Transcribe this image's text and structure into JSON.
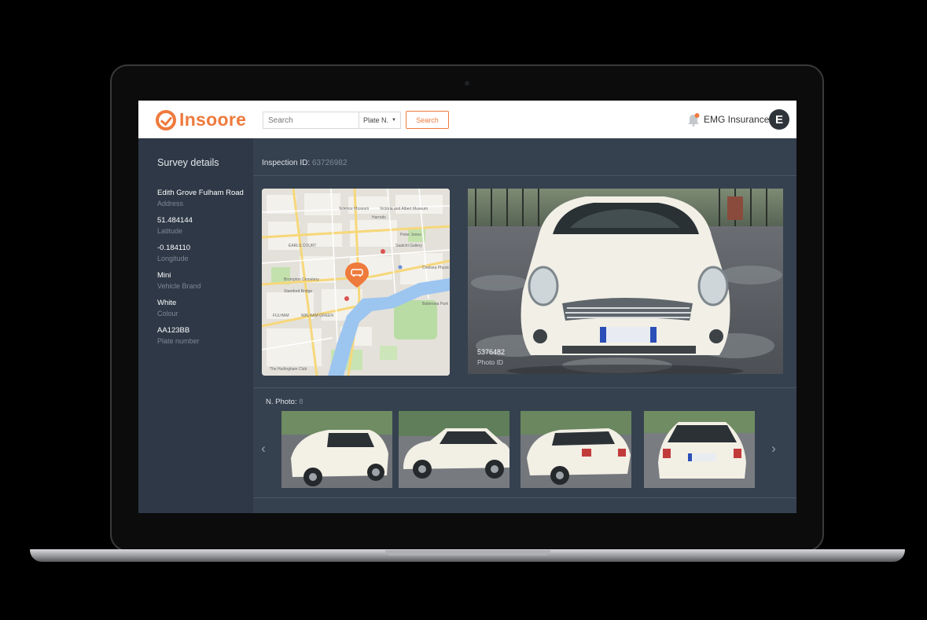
{
  "brand": {
    "name": "Insoore",
    "accent": "#ee7a3c"
  },
  "header": {
    "search_placeholder": "Search",
    "search_type": "Plate N.",
    "search_button": "Search",
    "company": "EMG Insurance",
    "avatar_letter": "E"
  },
  "sidebar": {
    "title": "Survey details",
    "details": [
      {
        "value": "Edith Grove Fulham Road",
        "label": "Address"
      },
      {
        "value": "51.484144",
        "label": "Latitude"
      },
      {
        "value": "-0.184110",
        "label": "Longitude"
      },
      {
        "value": "Mini",
        "label": "Vehicle Brand"
      },
      {
        "value": "White",
        "label": "Colour"
      },
      {
        "value": "AA123BB",
        "label": "Plate number"
      }
    ]
  },
  "main": {
    "inspection_label": "Inspection ID:",
    "inspection_id": "63726982",
    "photo_id": "5376482",
    "photo_id_label": "Photo ID",
    "nphoto_label": "N. Photo:",
    "nphoto_count": "8"
  },
  "map": {
    "labels": [
      "Science Museum",
      "Victoria and Albert Museum",
      "EARLS COURT",
      "Saatchi Gallery",
      "Chelsea Physic",
      "Brompton Cemetery",
      "Stamford Bridge",
      "Battersea Park",
      "FULHAM",
      "WALHAM GREEN",
      "The Hurlingham Club",
      "Peter Jones",
      "Harrods"
    ]
  }
}
